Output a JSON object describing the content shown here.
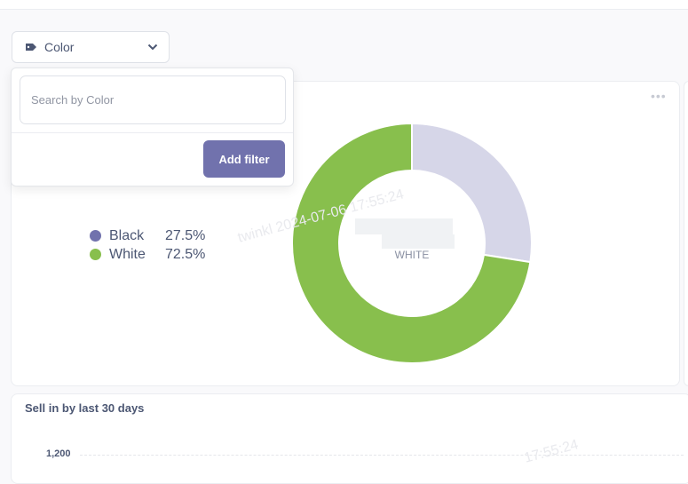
{
  "filter": {
    "label": "Color",
    "icon": "tag-icon",
    "chevron": "chevron-down-icon"
  },
  "popover": {
    "search_placeholder": "Search by Color",
    "add_filter_label": "Add filter"
  },
  "card": {
    "more_icon": "more-icon"
  },
  "chart_data": {
    "type": "pie",
    "donut": true,
    "categories": [
      "Black",
      "White"
    ],
    "values": [
      27.5,
      72.5
    ],
    "value_labels": [
      "27.5%",
      "72.5%"
    ],
    "colors": [
      "#d6d6e8",
      "#88bf4d"
    ],
    "legend_colors": [
      "#7172ad",
      "#88bf4d"
    ],
    "center_label": "WHITE",
    "legend_position": "left"
  },
  "sell_chart": {
    "title": "Sell in by last 30 days",
    "y_ticks": [
      "1,200"
    ]
  },
  "watermark": {
    "text_1": "twinkl 2024-07-06 17:55:24",
    "text_2": "17:55:24"
  }
}
